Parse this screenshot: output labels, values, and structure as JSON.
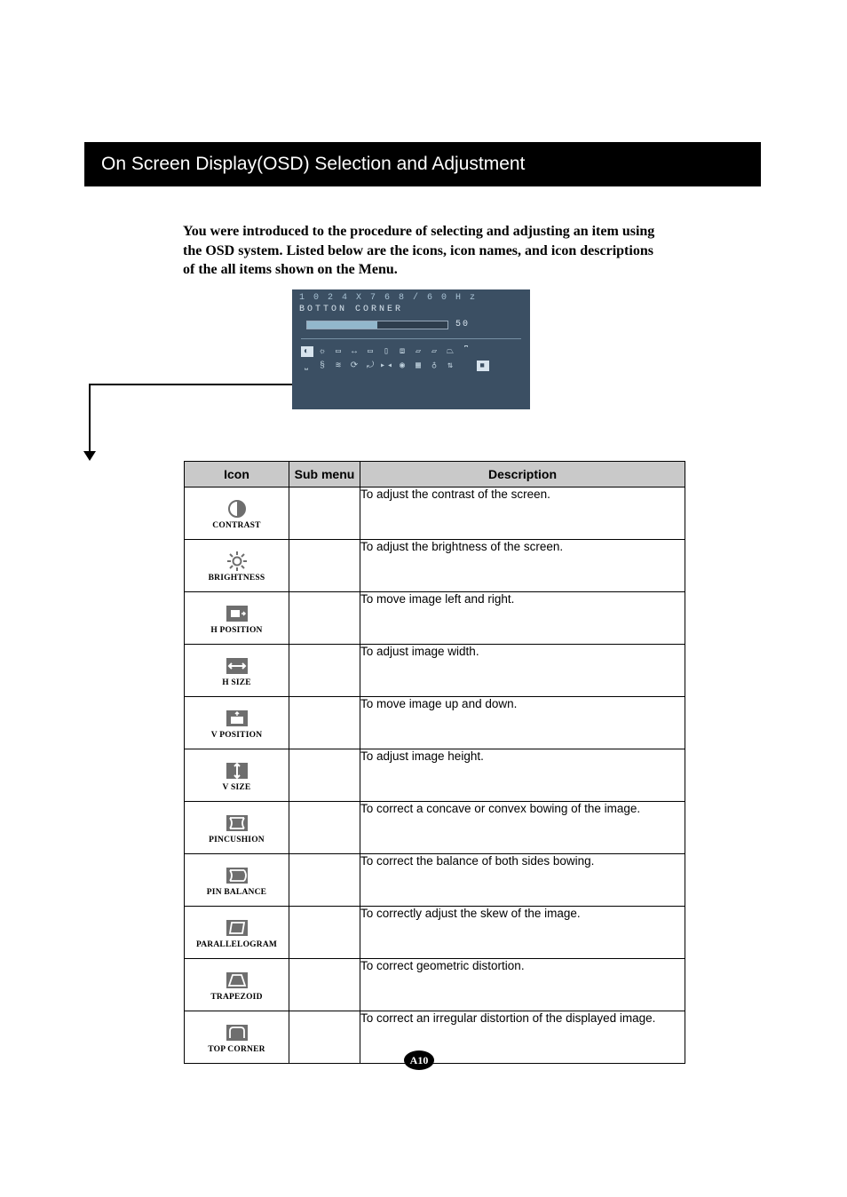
{
  "title": "On Screen Display(OSD) Selection and Adjustment",
  "intro": "You were introduced to the procedure of selecting and adjusting an item using the OSD system.  Listed below are the icons, icon names, and icon descriptions of the all items shown on the Menu.",
  "osd": {
    "resolution": "1 0 2 4 X 7 6 8 / 6 0 H z",
    "current_item": "BOTTON CORNER",
    "value": "50"
  },
  "chart_data": {
    "type": "table",
    "headers": [
      "Icon",
      "Sub menu",
      "Description"
    ],
    "rows": [
      {
        "icon": "CONTRAST",
        "sub": "",
        "desc": "To adjust the contrast of the screen."
      },
      {
        "icon": "BRIGHTNESS",
        "sub": "",
        "desc": "To adjust the brightness of the screen."
      },
      {
        "icon": "H POSITION",
        "sub": "",
        "desc": "To move image left and right."
      },
      {
        "icon": "H SIZE",
        "sub": "",
        "desc": "To adjust image width."
      },
      {
        "icon": "V POSITION",
        "sub": "",
        "desc": "To move image up and down."
      },
      {
        "icon": "V SIZE",
        "sub": "",
        "desc": "To adjust image height."
      },
      {
        "icon": "PINCUSHION",
        "sub": "",
        "desc": "To correct a concave or convex bowing of the image."
      },
      {
        "icon": "PIN BALANCE",
        "sub": "",
        "desc": "To correct the balance of both sides bowing."
      },
      {
        "icon": "PARALLELOGRAM",
        "sub": "",
        "desc": "To correctly adjust the skew of the image."
      },
      {
        "icon": "TRAPEZOID",
        "sub": "",
        "desc": "To correct geometric distortion."
      },
      {
        "icon": "TOP CORNER",
        "sub": "",
        "desc": "To correct an irregular distortion of the displayed image."
      }
    ]
  },
  "page_number": "A10"
}
